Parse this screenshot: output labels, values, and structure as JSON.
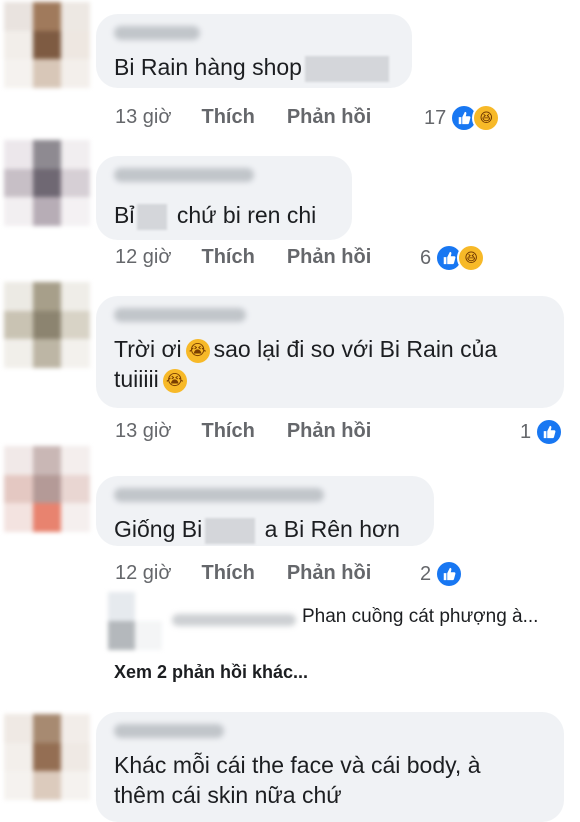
{
  "comments": [
    {
      "text": "Bi Rain hàng shop",
      "time": "13 giờ",
      "like": "Thích",
      "reply": "Phản hồi",
      "reaction_count": "17",
      "reactions": [
        "like-icon",
        "haha-icon"
      ]
    },
    {
      "text_before": "Bỉ",
      "text_after": "chứ bi ren chi",
      "time": "12 giờ",
      "like": "Thích",
      "reply": "Phản hồi",
      "reaction_count": "6",
      "reactions": [
        "like-icon",
        "haha-icon"
      ]
    },
    {
      "line1_before": "Trời ơi",
      "line1_after": "sao lại đi so với Bi Rain của",
      "line2": "tuiiiii",
      "time": "13 giờ",
      "like": "Thích",
      "reply": "Phản hồi",
      "reaction_count": "1",
      "reactions": [
        "like-icon"
      ],
      "emoji": "crying-face-icon"
    },
    {
      "text_before": "Giống Bi",
      "text_after": "a Bi Rên hơn",
      "time": "12 giờ",
      "like": "Thích",
      "reply": "Phản hồi",
      "reaction_count": "2",
      "reactions": [
        "like-icon"
      ]
    },
    {
      "line1": "Khác mỗi cái the face và cái body, à",
      "line2": "thêm cái skin nữa chứ"
    }
  ],
  "reply_preview": {
    "text": "Phan cuồng cát phượng à..."
  },
  "more_replies": "Xem 2 phản hồi khác...",
  "colors": {
    "bubble": "#f0f2f5",
    "like_blue": "#1877f2",
    "meta_gray": "#65676b",
    "emoji_yellow": "#f7b928"
  }
}
